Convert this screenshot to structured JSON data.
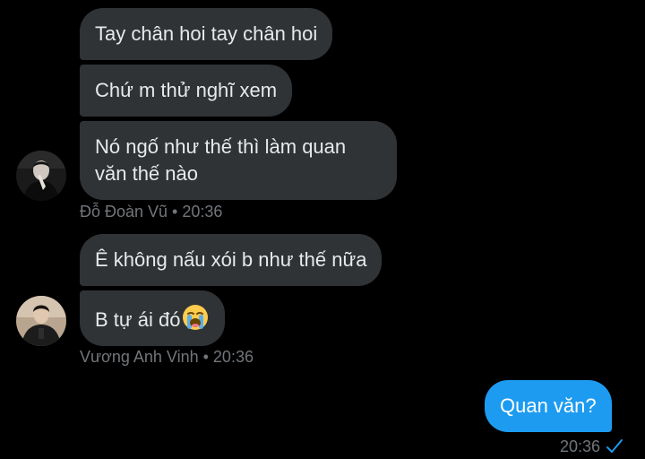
{
  "messages": [
    {
      "text": "Tay chân hoi tay chân hoi"
    },
    {
      "text": "Chứ m thử nghĩ xem"
    },
    {
      "text": "Nó ngố như thế thì làm quan văn thế nào"
    },
    {
      "text": "Ê không nấu xói b như thế nữa"
    },
    {
      "text": "B tự ái đó",
      "emoji": "loudly-crying-face"
    },
    {
      "text": "Quan văn?"
    }
  ],
  "meta": {
    "group1": "Đỗ Đoàn Vũ • 20:36",
    "group2": "Vương Anh Vinh • 20:36",
    "sent_time": "20:36"
  },
  "colors": {
    "background": "#000000",
    "incoming_bubble": "#2f3336",
    "outgoing_bubble": "#1d9bf0",
    "meta_text": "#71767b",
    "read_check": "#1d9bf0"
  }
}
